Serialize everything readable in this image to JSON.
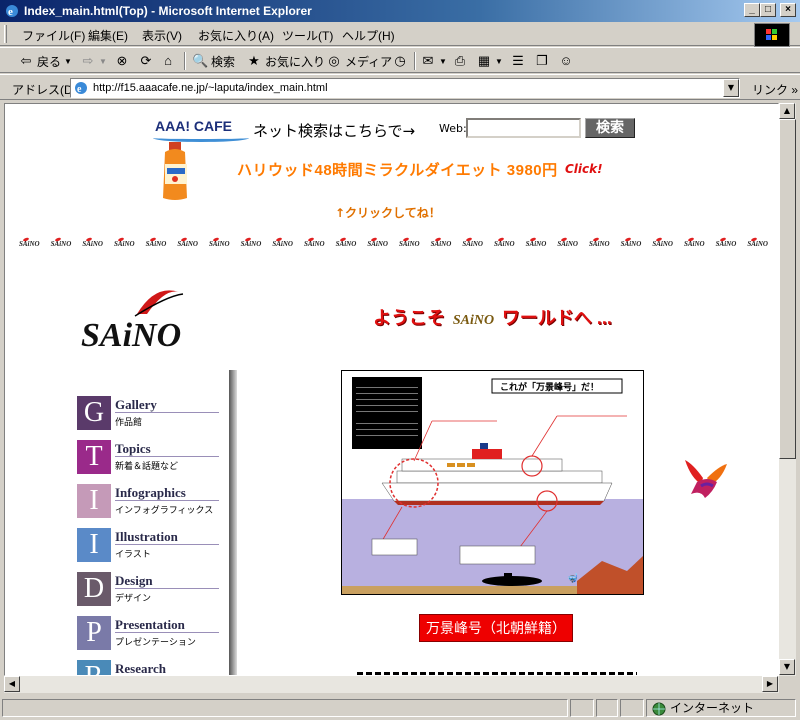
{
  "window": {
    "title": "Index_main.html(Top) - Microsoft Internet Explorer",
    "buttons": {
      "minimize": "_",
      "maximize": "□",
      "close": "×"
    }
  },
  "menu": {
    "items": [
      "ファイル(F)",
      "編集(E)",
      "表示(V)",
      "お気に入り(A)",
      "ツール(T)",
      "ヘルプ(H)"
    ]
  },
  "toolbar": {
    "back": "戻る",
    "search": "検索",
    "favorites": "お気に入り",
    "media": "メディア"
  },
  "address": {
    "label": "アドレス(D)",
    "url": "http://f15.aaacafe.ne.jp/~laputa/index_main.html",
    "links": "リンク »"
  },
  "status": {
    "zone": "インターネット"
  },
  "page": {
    "aaa_logo": "AAA! CAFE",
    "net_search": "ネット検索はこちらで→",
    "web_label": "Web:",
    "web_value": "",
    "search_button": "検索",
    "ad_text": "ハリウッド48時間ミラクルダイエット 3980円",
    "ad_click": "Click!",
    "click_note": "↑クリックしてね！",
    "brand": "SAiNO",
    "welcome_1": "ようこそ",
    "welcome_brand": "SAiNO",
    "welcome_2": "ワールドへ ...",
    "ship_title": "これが「万景峰号」だ！",
    "ship_caption": "万景峰号（北朝鮮籍）",
    "nav": [
      {
        "letter": "G",
        "name": "Gallery",
        "jp": "作品館",
        "color": "#5a3a6a"
      },
      {
        "letter": "T",
        "name": "Topics",
        "jp": "新着＆話題など",
        "color": "#9a2a8a"
      },
      {
        "letter": "I",
        "name": "Infographics",
        "jp": "インフォグラフィックス",
        "color": "#c59ab8"
      },
      {
        "letter": "I",
        "name": "Illustration",
        "jp": "イラスト",
        "color": "#5a8ac8"
      },
      {
        "letter": "D",
        "name": "Design",
        "jp": "デザイン",
        "color": "#6a5a6a"
      },
      {
        "letter": "P",
        "name": "Presentation",
        "jp": "プレゼンテーション",
        "color": "#7a7aa8"
      },
      {
        "letter": "R",
        "name": "Research",
        "jp": "",
        "color": "#4a8ab8"
      }
    ]
  }
}
